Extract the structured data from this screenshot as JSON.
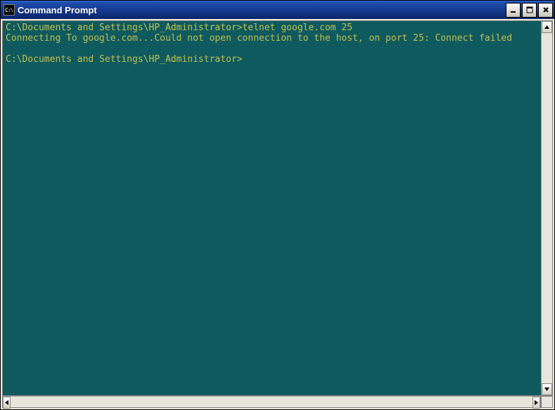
{
  "window": {
    "title": "Command Prompt",
    "icon_label": "C:\\"
  },
  "console": {
    "line1_prompt": "C:\\Documents and Settings\\HP_Administrator>",
    "line1_cmd": "telnet google.com 25",
    "line2": "Connecting To google.com...Could not open connection to the host, on port 25: Connect failed",
    "blank": "",
    "line3_prompt": "C:\\Documents and Settings\\HP_Administrator>"
  },
  "colors": {
    "console_bg": "#0f5a5e",
    "console_fg": "#c0c050"
  }
}
